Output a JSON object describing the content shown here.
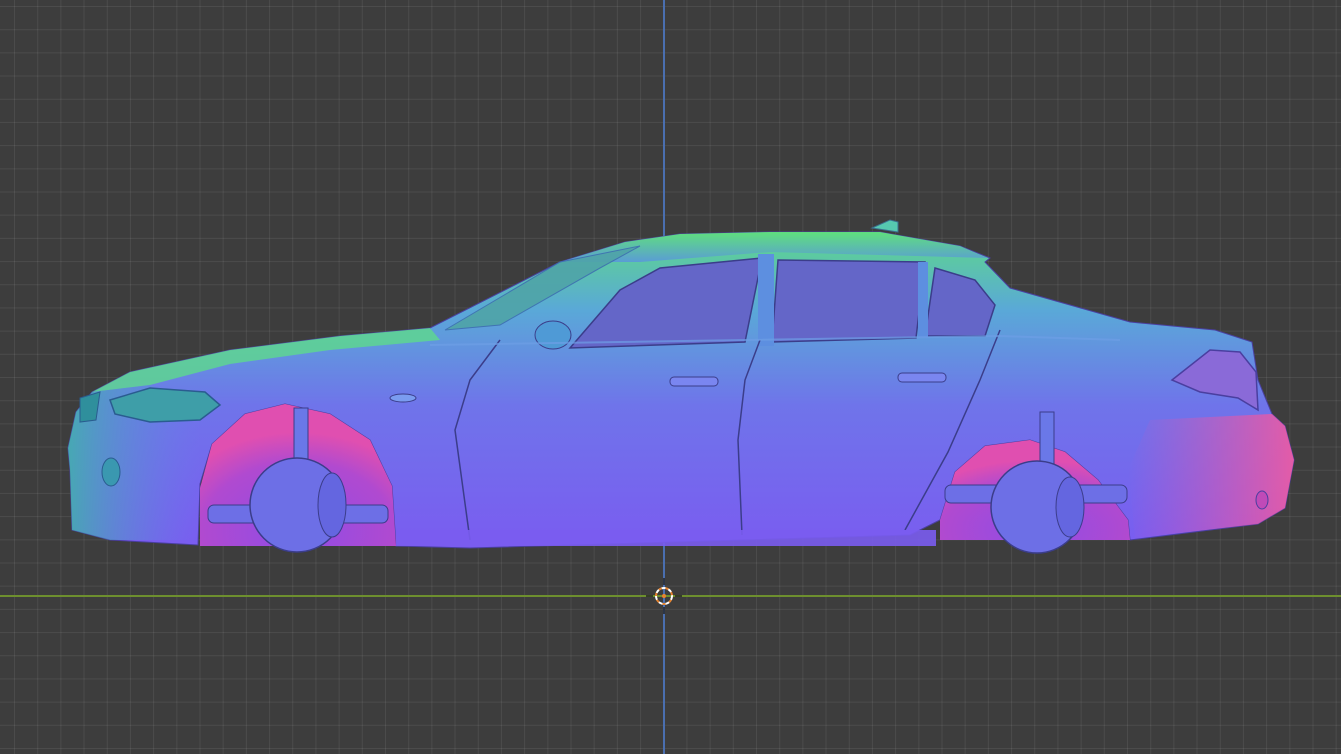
{
  "viewport": {
    "view": "side-orthographic",
    "background_color": "#3d3d3d",
    "grid_visible": true
  },
  "axes": {
    "z_axis_color": "#4a6fb0",
    "y_axis_color": "#6d8f2e"
  },
  "object": {
    "name": "car-sedan",
    "shading": "normal-map",
    "palette": [
      "#7a5cf0",
      "#5b8ee6",
      "#55d98a",
      "#e04fb0"
    ]
  },
  "cursor": {
    "icon": "3d-cursor-icon",
    "color": "#e8842f"
  }
}
